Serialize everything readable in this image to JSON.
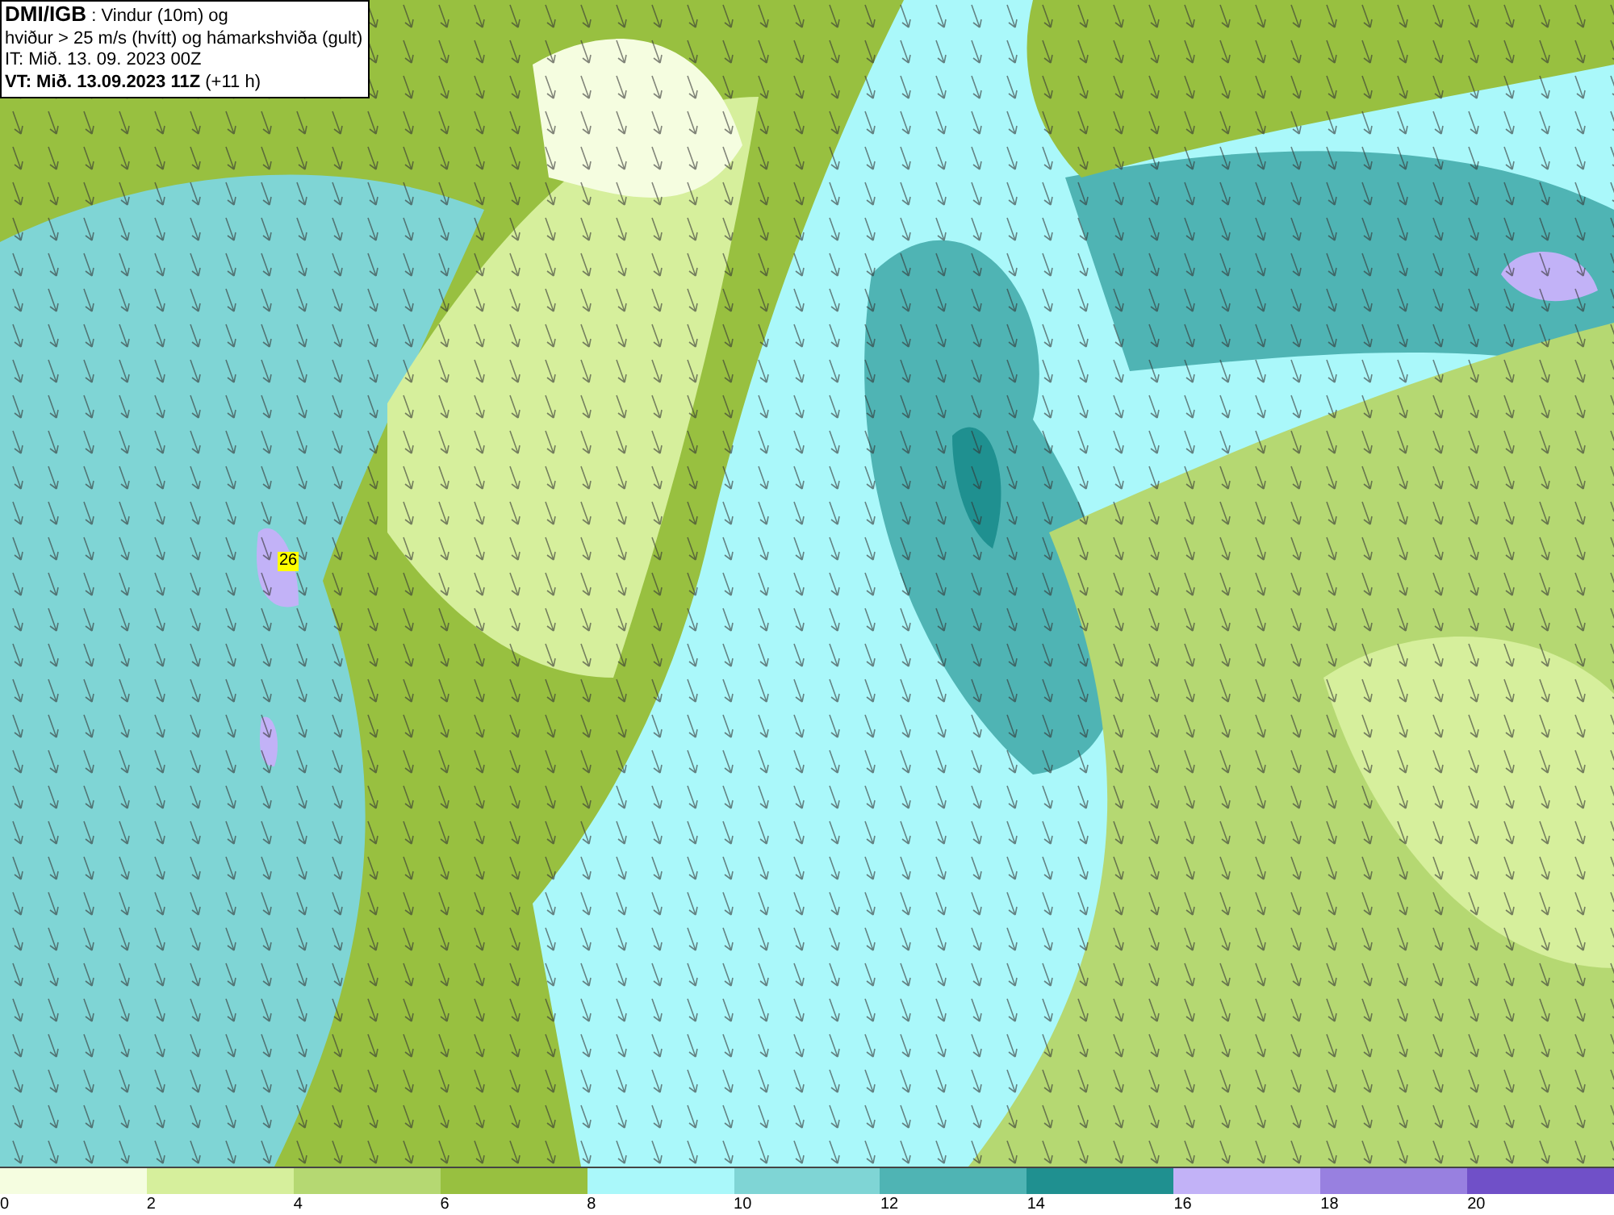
{
  "header": {
    "lines": [
      "**DMI/IGB** : Vindur (10m) og",
      "hviður > 25 m/s (hvítt) og hámarkshviða (gult)",
      "IT: Mið. 13. 09. 2023 00Z",
      "**VT: Mið. 13.09.2023 11Z** (+11 h)"
    ]
  },
  "map": {
    "gust_label": "26"
  },
  "legend": {
    "items": [
      {
        "value": "0",
        "color": "#f5fde0"
      },
      {
        "value": "2",
        "color": "#d6ef9c"
      },
      {
        "value": "4",
        "color": "#b5d872"
      },
      {
        "value": "6",
        "color": "#98c040"
      },
      {
        "value": "8",
        "color": "#aaf8fa"
      },
      {
        "value": "10",
        "color": "#7fd5d5"
      },
      {
        "value": "12",
        "color": "#4fb4b4"
      },
      {
        "value": "14",
        "color": "#1f9090"
      },
      {
        "value": "16",
        "color": "#c2b2f7"
      },
      {
        "value": "18",
        "color": "#9880e0"
      },
      {
        "value": "20",
        "color": "#7050c8"
      }
    ]
  }
}
